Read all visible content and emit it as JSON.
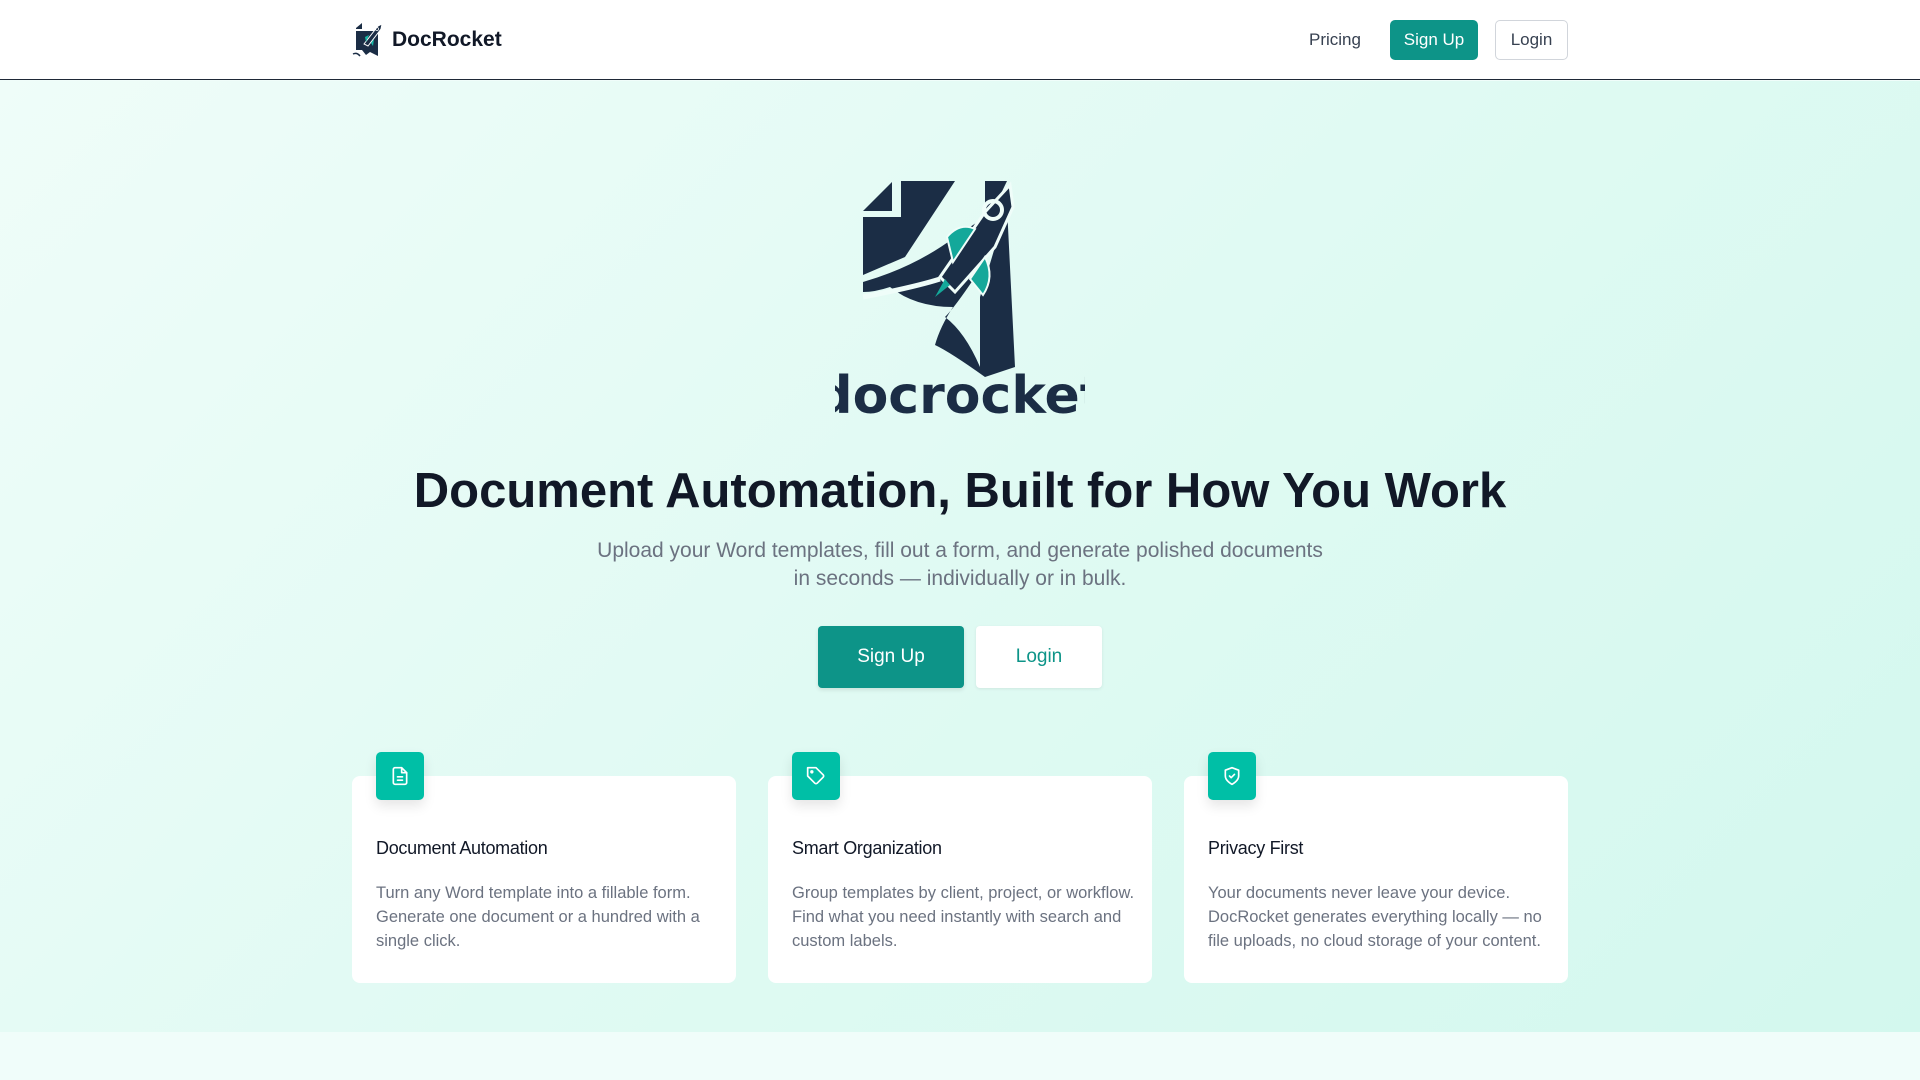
{
  "nav": {
    "brand": "DocRocket",
    "pricing": "Pricing",
    "signup": "Sign Up",
    "login": "Login"
  },
  "hero": {
    "logo_text": "docrocket",
    "title": "Document Automation, Built for How You Work",
    "subtitle": "Upload your Word templates, fill out a form, and generate polished documents in seconds — individually or in bulk.",
    "signup": "Sign Up",
    "login": "Login"
  },
  "features": [
    {
      "icon": "file-text-icon",
      "title": "Document Automation",
      "description": "Turn any Word template into a fillable form. Generate one document or a hundred with a single click."
    },
    {
      "icon": "tag-icon",
      "title": "Smart Organization",
      "description": "Group templates by client, project, or workflow. Find what you need instantly with search and custom labels."
    },
    {
      "icon": "shield-check-icon",
      "title": "Privacy First",
      "description": "Your documents never leave your device. DocRocket generates everything locally — no file uploads, no cloud storage of your content."
    }
  ],
  "colors": {
    "accent": "#0d9488",
    "icon_bg": "#00bfa6",
    "navy": "#1b2d45"
  }
}
